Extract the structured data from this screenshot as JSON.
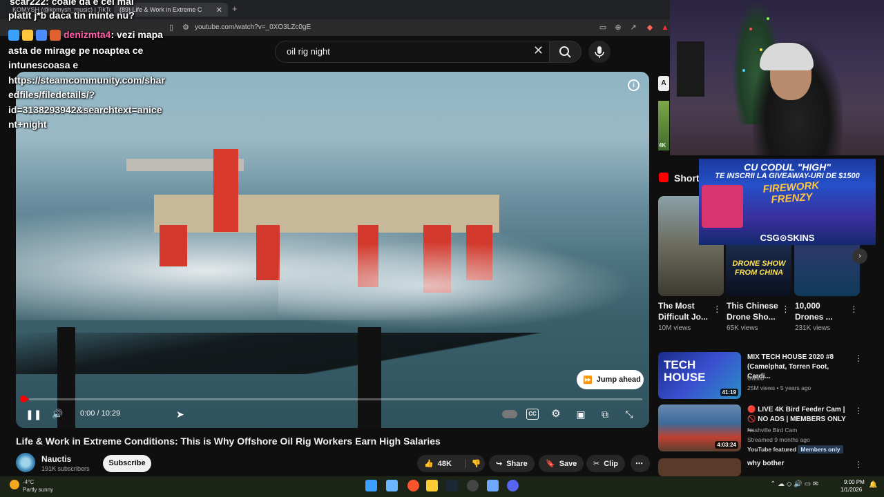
{
  "browser": {
    "tabs": [
      {
        "label": "KOMYSH (@komysh_music) | TikTok"
      },
      {
        "label": "(89) Life & Work in Extreme C"
      }
    ],
    "url": "youtube.com/watch?v=_0XO3LZc0gE"
  },
  "search": {
    "query": "oil rig night"
  },
  "player": {
    "time": "0:00 / 10:29",
    "jump_ahead_label": "Jump ahead",
    "progress_fraction": 0.01,
    "cc_label": "CC"
  },
  "video": {
    "title": "Life & Work in Extreme Conditions: This is Why Offshore Oil Rig Workers Earn High Salaries",
    "channel": "Nauctis",
    "subscribers": "191K subscribers",
    "subscribe_label": "Subscribe",
    "actions": {
      "likes": "48K",
      "share": "Share",
      "save": "Save",
      "clip": "Clip"
    }
  },
  "sidebar": {
    "ad_badge": "A",
    "ad_quality": "4K",
    "shorts_heading": "Short",
    "shorts": [
      {
        "title": "The Most Difficult Jo...",
        "views": "10M views",
        "overlay": ""
      },
      {
        "title": "This Chinese Drone Sho...",
        "views": "65K views",
        "overlay": "DRONE SHOW FROM CHINA"
      },
      {
        "title": "10,000 Drones ...",
        "views": "231K views",
        "overlay": ""
      }
    ],
    "videos": [
      {
        "title": "MIX TECH HOUSE 2020 #8 (Camelphat, Torren Foot, Cardi...",
        "channel": "Gatillo",
        "meta": "25M views • 5 years ago",
        "duration": "41:19",
        "thumb_text": "TECH HOUSE"
      },
      {
        "title": "🔴 LIVE 4K Bird Feeder Cam | 🚫 NO ADS | MEMBERS ONLY ...",
        "channel": "Nashville Bird Cam",
        "meta": "Streamed 9 months ago",
        "duration": "4:03:24",
        "featured": "YouTube featured",
        "members": "Members only"
      },
      {
        "title": "why bother",
        "channel": "",
        "meta": "",
        "duration": ""
      }
    ]
  },
  "chat": {
    "line0": "scar222: coaie da e cel mai",
    "line1": "platit  j*b  daca tin minte nu?",
    "author": "denizmta4",
    "line2_rest": ": vezi mapa",
    "line3": "asta de mirage pe noaptea ce",
    "line4": "intunescoasa e",
    "line5": "https://steamcommunity.com/shar",
    "line6": "edfiles/filedetails/?",
    "line7": "id=3138293942&searchtext=anice",
    "line8": "nt+night"
  },
  "banner": {
    "line1": "CU CODUL \"HIGH\"",
    "line2": "TE INSCRII LA GIVEAWAY-URI DE $1500",
    "game": "FIREWORK FRENZY",
    "brand": "CSG⊙SKINS"
  },
  "taskbar": {
    "temp": "-4°C",
    "weather": "Partly sunny",
    "time": "9:00 PM",
    "date": "1/1/2026"
  }
}
